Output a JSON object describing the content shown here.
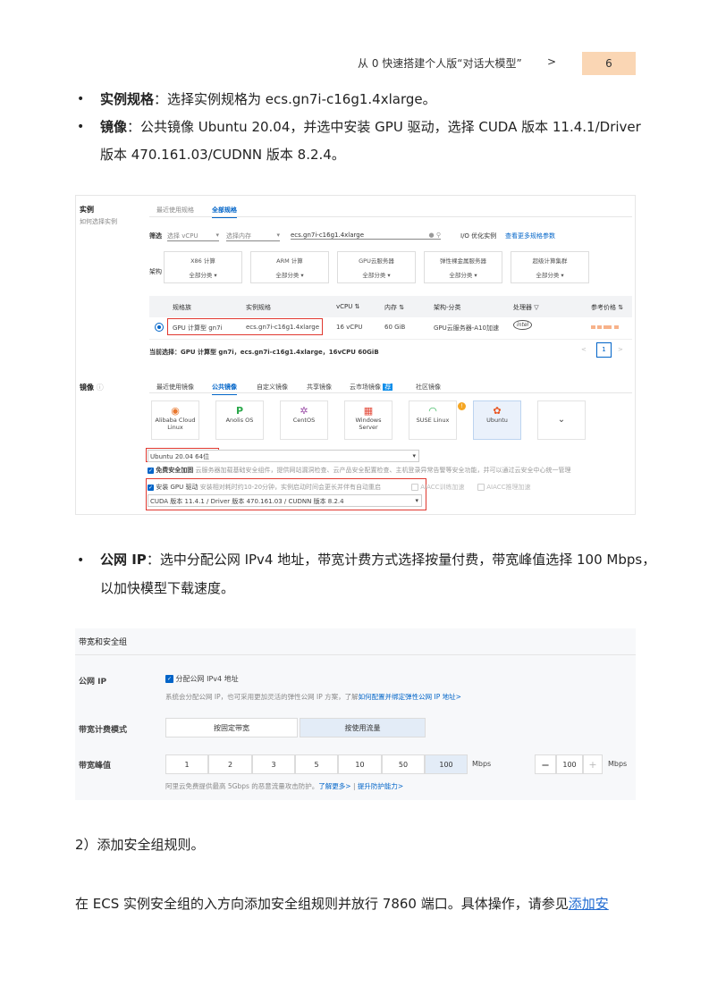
{
  "header": {
    "title": "从 0 快速搭建个人版“对话大模型”",
    "arrow": ">",
    "page_number": "6"
  },
  "bullets": [
    {
      "bold": "实例规格",
      "text": "：选择实例规格为 ecs.gn7i-c16g1.4xlarge。"
    },
    {
      "bold": "镜像",
      "text": "：公共镜像 Ubuntu 20.04，并选中安装 GPU 驱动，选择 CUDA 版本 11.4.1/Driver",
      "text2": "版本 470.161.03/CUDNN 版本 8.2.4。"
    },
    {
      "bold": "公网 IP",
      "text": "：选中分配公网 IPv4 地址，带宽计费方式选择按量付费，带宽峰值选择 100 Mbps，",
      "text2": "以加快模型下载速度。"
    }
  ],
  "shot1": {
    "instance_label": "实例",
    "instance_help": "如何选择实例",
    "tabs": [
      "最近使用规格",
      "全部规格"
    ],
    "filter_label": "筛选",
    "filter_vcpu": "选择 vCPU",
    "filter_mem": "选择内存",
    "filter_search": "ecs.gn7i-c16g1.4xlarge",
    "io_opt": "I/O 优化实例",
    "more_params": "查看更多规格参数",
    "arch_label": "架构",
    "arch_boxes": [
      {
        "t": "X86 计算",
        "d": "全部分类"
      },
      {
        "t": "ARM 计算",
        "d": "全部分类"
      },
      {
        "t": "GPU云服务器",
        "d": "全部分类"
      },
      {
        "t": "弹性裸金属服务器",
        "d": "全部分类"
      },
      {
        "t": "超级计算集群",
        "d": "全部分类"
      }
    ],
    "table_headers": [
      "规格族",
      "实例规格",
      "vCPU ⇅",
      "内存 ⇅",
      "架构-分类",
      "处理器 ▽",
      "参考价格 ⇅"
    ],
    "row": [
      "GPU 计算型 gn7i",
      "ecs.gn7i-c16g1.4xlarge",
      "16 vCPU",
      "60 GiB",
      "GPU云服务器-A10加速",
      "intel"
    ],
    "current_selection": "当前选择：GPU 计算型 gn7i，ecs.gn7i-c16g1.4xlarge，16vCPU 60GiB",
    "pager": "1",
    "image_label": "镜像",
    "image_tabs": [
      "最近使用镜像",
      "公共镜像",
      "自定义镜像",
      "共享镜像",
      "云市场镜像",
      "社区镜像"
    ],
    "image_badge": "荐",
    "image_cards": [
      "Alibaba Cloud Linux",
      "Anolis OS",
      "CentOS",
      "Windows Server",
      "SUSE Linux",
      "Ubuntu"
    ],
    "ubuntu_version": "Ubuntu 20.04 64位",
    "free_security": "免费安全加固",
    "free_security_desc": "云服务器加载基础安全组件，提供网站漏洞检查、云产品安全配置检查、主机登录异常告警等安全功能，并可以通过云安全中心统一管理",
    "gpu_driver": "安装 GPU 驱动",
    "gpu_driver_desc": "安装相对耗时约10-20分钟，实例启动时间会更长并伴有自动重启",
    "aiacc_train": "AIACC训练加速",
    "aiacc_infer": "AIACC推理加速",
    "cuda_version": "CUDA 版本 11.4.1 / Driver 版本 470.161.03 / CUDNN 版本 8.2.4"
  },
  "shot2": {
    "section_title": "带宽和安全组",
    "public_ip_label": "公网 IP",
    "assign_ipv4": "分配公网 IPv4 地址",
    "ip_desc": "系统会分配公网 IP，也可采用更加灵活的弹性公网 IP 方案，了解",
    "ip_link": "如何配置并绑定弹性公网 IP 地址>",
    "billing_label": "带宽计费模式",
    "billing_options": [
      "按固定带宽",
      "按使用流量"
    ],
    "peak_label": "带宽峰值",
    "peak_options": [
      "1",
      "2",
      "3",
      "5",
      "10",
      "50",
      "100"
    ],
    "peak_unit": "Mbps",
    "stepper_minus": "—",
    "stepper_value": "100",
    "stepper_plus": "+",
    "stepper_unit": "Mbps",
    "ddos_desc": "阿里云免费提供最高 5Gbps 的恶意流量攻击防护。",
    "ddos_link1": "了解更多>",
    "ddos_sep": "|",
    "ddos_link2": "提升防护能力>"
  },
  "step2": {
    "title": "2）添加安全组规则。"
  },
  "final": {
    "text": "在 ECS 实例安全组的入方向添加安全组规则并放行 7860 端口。具体操作，请参见",
    "link": "添加安"
  }
}
